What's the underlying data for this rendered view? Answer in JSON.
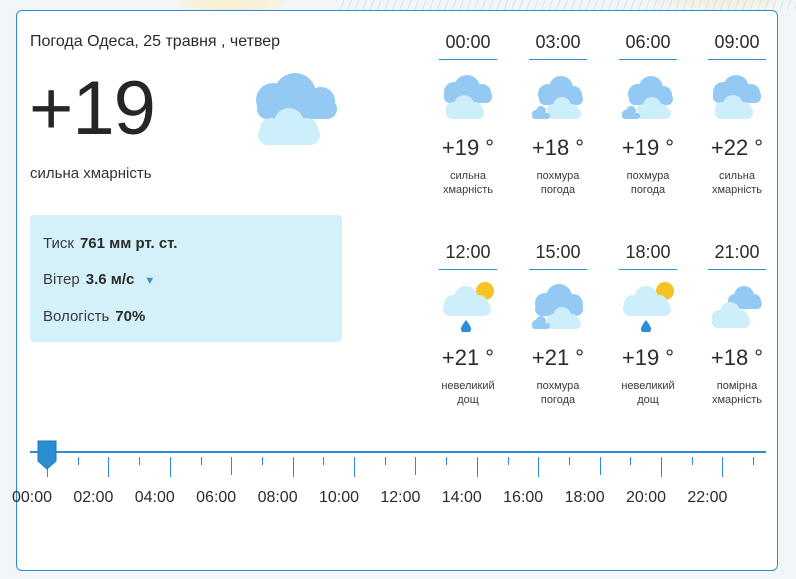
{
  "header": {
    "location_date": "Погода Одеса, 25 травня , четвер"
  },
  "current": {
    "temperature": "+19",
    "description": "сильна хмарність",
    "icon": "cloudy-icon",
    "pressure_label": "Тиск",
    "pressure_value": "761 мм рт. ст.",
    "wind_label": "Вітер",
    "wind_value": "3.6 м/с",
    "wind_icon": "wind-direction-arrow-icon",
    "humidity_label": "Вологість",
    "humidity_value": "70%"
  },
  "hourly": [
    {
      "time": "00:00",
      "temp": "+19 °",
      "desc1": "сильна",
      "desc2": "хмарність",
      "icon": "cloudy-icon"
    },
    {
      "time": "03:00",
      "temp": "+18 °",
      "desc1": "похмура",
      "desc2": "погода",
      "icon": "overcast-icon"
    },
    {
      "time": "06:00",
      "temp": "+19 °",
      "desc1": "похмура",
      "desc2": "погода",
      "icon": "overcast-icon"
    },
    {
      "time": "09:00",
      "temp": "+22 °",
      "desc1": "сильна",
      "desc2": "хмарність",
      "icon": "cloudy-icon"
    },
    {
      "time": "12:00",
      "temp": "+21 °",
      "desc1": "невеликий",
      "desc2": "дощ",
      "icon": "sun-cloud-rain-icon"
    },
    {
      "time": "15:00",
      "temp": "+21 °",
      "desc1": "похмура",
      "desc2": "погода",
      "icon": "overcast-icon"
    },
    {
      "time": "18:00",
      "temp": "+19 °",
      "desc1": "невеликий",
      "desc2": "дощ",
      "icon": "sun-cloud-rain-icon"
    },
    {
      "time": "21:00",
      "temp": "+18 °",
      "desc1": "помірна",
      "desc2": "хмарність",
      "icon": "partly-cloudy-icon"
    }
  ],
  "timeline": {
    "labels": [
      "00:00",
      "02:00",
      "04:00",
      "06:00",
      "08:00",
      "10:00",
      "12:00",
      "14:00",
      "16:00",
      "18:00",
      "20:00",
      "22:00"
    ],
    "selected": "00:00"
  },
  "colors": {
    "accent": "#2a8fd0",
    "panel": "#d4f1fa",
    "cloud_light": "#cdeefb",
    "cloud_dark": "#93c9f2",
    "sun": "#f5c324",
    "rain": "#2b8fd9"
  }
}
